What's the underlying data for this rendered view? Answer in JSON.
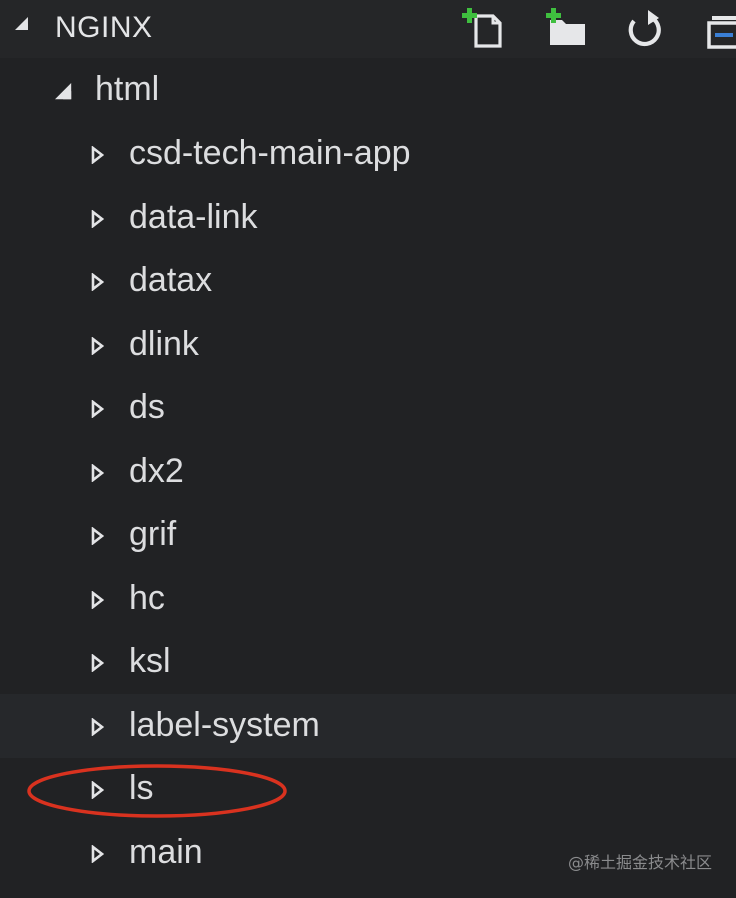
{
  "header": {
    "section_title": "NGINX",
    "actions": [
      {
        "name": "new-file",
        "icon": "new-file-icon"
      },
      {
        "name": "new-folder",
        "icon": "new-folder-icon"
      },
      {
        "name": "refresh",
        "icon": "refresh-icon"
      },
      {
        "name": "collapse-all",
        "icon": "collapse-all-icon"
      }
    ]
  },
  "tree": {
    "root": {
      "label": "html",
      "expanded": true
    },
    "items": [
      {
        "label": "csd-tech-main-app"
      },
      {
        "label": "data-link"
      },
      {
        "label": "datax"
      },
      {
        "label": "dlink"
      },
      {
        "label": "ds"
      },
      {
        "label": "dx2"
      },
      {
        "label": "grif"
      },
      {
        "label": "hc"
      },
      {
        "label": "ksl"
      },
      {
        "label": "label-system"
      },
      {
        "label": "ls"
      },
      {
        "label": "main"
      }
    ]
  },
  "watermark": "@稀土掘金技术社区",
  "colors": {
    "background": "#212224",
    "header_background": "#252628",
    "text": "#dcdddf",
    "add_badge": "#3fbf3f",
    "annotation": "#d9321f"
  }
}
